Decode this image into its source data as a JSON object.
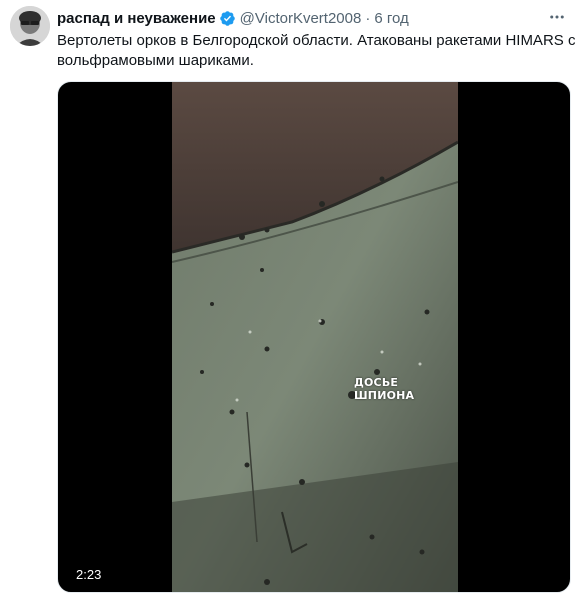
{
  "tweet": {
    "author_name": "распад и неуважение",
    "handle": "@VictorKvert2008",
    "separator": "·",
    "time": "6 год",
    "text": "Вертолеты орков в Белгородской области. Атакованы ракетами HIMARS с вольфрамовыми шариками.",
    "verified": true,
    "icons": {
      "avatar": "avatar-image",
      "verified": "verified-badge-icon",
      "more": "more-options-icon"
    },
    "colors": {
      "name": "#0f1419",
      "secondary": "#536471",
      "verified": "#1d9bf0"
    }
  },
  "video": {
    "overlay_text": "ДОСЬЕ ШПИОНА",
    "duration": "2:23"
  }
}
